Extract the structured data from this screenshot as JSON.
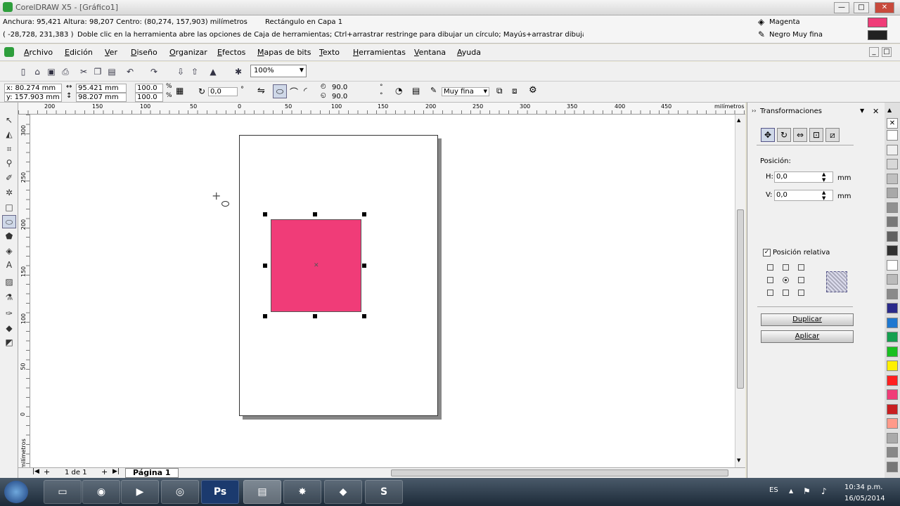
{
  "window": {
    "title": "CorelDRAW X5 - [Gráfico1]"
  },
  "status": {
    "dims": "Anchura: 95,421  Altura: 98,207  Centro: (80,274, 157,903)  milímetros",
    "object": "Rectángulo en Capa 1",
    "coords": "( -28,728, 231,383 )",
    "hint": "Doble clic en la herramienta abre las opciones de Caja de herramientas; Ctrl+arrastrar restringe para dibujar un círculo; Mayús+arrastrar dibuja a ...",
    "fill_name": "Magenta",
    "outline_name": "Negro Muy fina",
    "fill_color": "#f03c78",
    "outline_color": "#222222"
  },
  "menu": [
    "Archivo",
    "Edición",
    "Ver",
    "Diseño",
    "Organizar",
    "Efectos",
    "Mapas de bits",
    "Texto",
    "Herramientas",
    "Ventana",
    "Ayuda"
  ],
  "toolbar": {
    "zoom": "100%"
  },
  "property_bar": {
    "x": "x: 80.274 mm",
    "y": "y: 157.903 mm",
    "w": "95.421 mm",
    "h": "98.207 mm",
    "scale_w": "100.0",
    "scale_h": "100.0",
    "percent": "%",
    "rotation": "0,0",
    "degree": "°",
    "corner_top": "90.0",
    "corner_bottom": "90.0",
    "outline_width": "Muy fina"
  },
  "ruler_h": [
    "200",
    "150",
    "100",
    "50",
    "0",
    "50",
    "100",
    "150",
    "200",
    "250",
    "300",
    "350",
    "400",
    "450"
  ],
  "ruler_h_unit": "milímetros",
  "ruler_v": [
    "300",
    "250",
    "200",
    "150",
    "100",
    "50",
    "0"
  ],
  "ruler_v_unit": "milímetros",
  "page_nav": {
    "count": "1 de 1",
    "tab": "Página 1"
  },
  "transform_panel": {
    "title": "Transformaciones",
    "section": "Posición:",
    "h_label": "H:",
    "h_value": "0,0",
    "v_label": "V:",
    "v_value": "0,0",
    "unit": "mm",
    "relative": "Posición relativa",
    "duplicate": "Duplicar",
    "apply": "Aplicar"
  },
  "palette": [
    "#ffffff",
    "#f0f0f0",
    "#d8d8d8",
    "#c0c0c0",
    "#a8a8a8",
    "#909090",
    "#787878",
    "#606060",
    "#303030",
    "#ffffff",
    "#bbbbbb",
    "#8a8a8a",
    "#2a2a8a",
    "#1e78d0",
    "#14a050",
    "#18c020",
    "#fff000",
    "#ff2020",
    "#f03c78",
    "#c81e20",
    "#ff9a8a",
    "#aaaaaa",
    "#888888",
    "#777777"
  ],
  "taskbar": {
    "lang": "ES",
    "time": "10:34 p.m.",
    "date": "16/05/2014",
    "ps_label": "Ps"
  }
}
